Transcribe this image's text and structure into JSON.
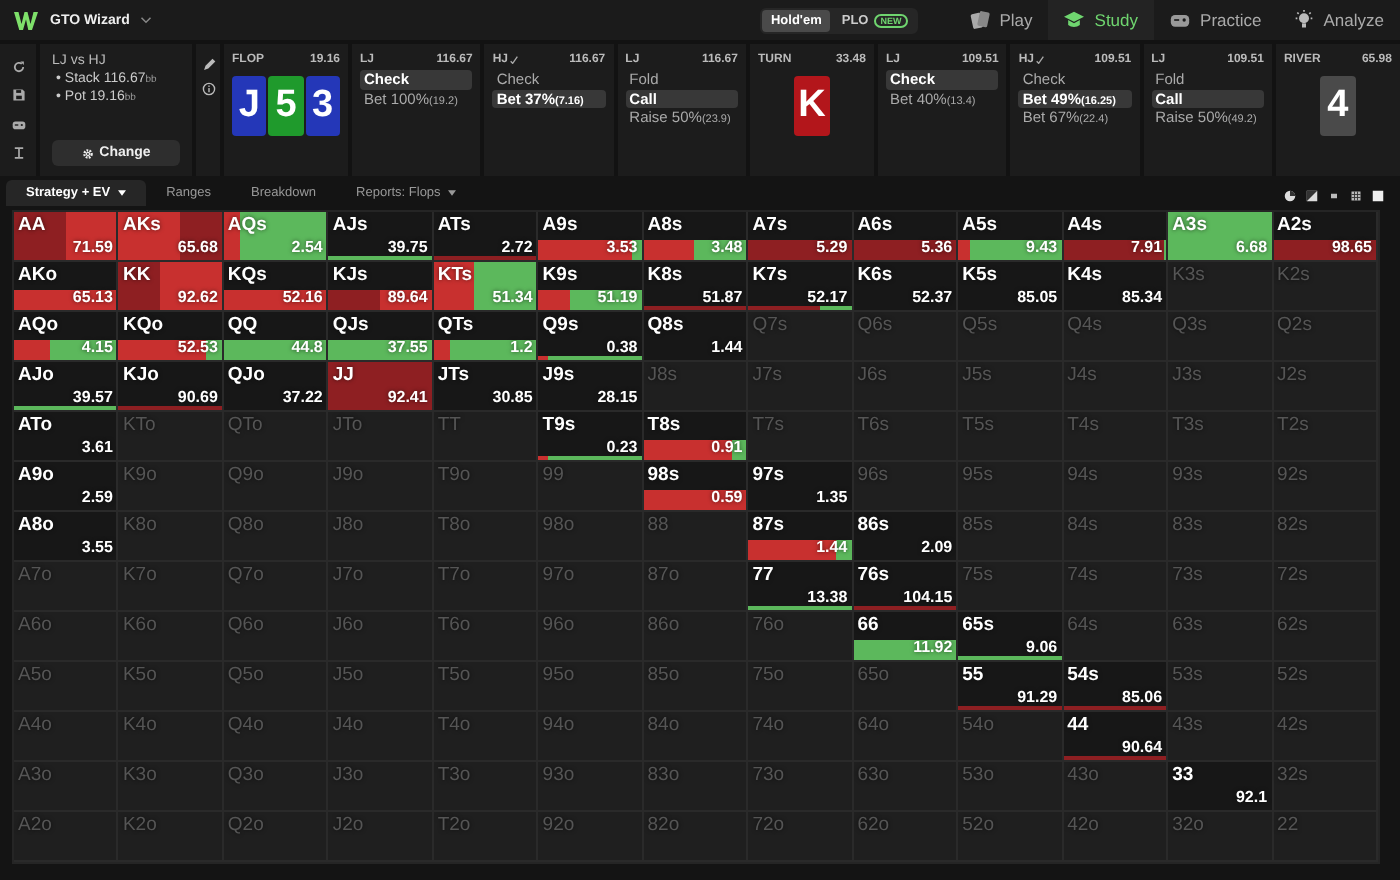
{
  "app": {
    "title": "GTO Wizard"
  },
  "variants": [
    {
      "label": "Hold'em",
      "selected": true
    },
    {
      "label": "PLO",
      "selected": false,
      "badge": "NEW"
    }
  ],
  "nav": [
    {
      "label": "Play",
      "selected": false,
      "kind": "cards"
    },
    {
      "label": "Study",
      "selected": true,
      "kind": "cap"
    },
    {
      "label": "Practice",
      "selected": false,
      "kind": "pad"
    },
    {
      "label": "Analyze",
      "selected": false,
      "kind": "bulb"
    }
  ],
  "spot": {
    "title": "LJ vs HJ",
    "stack_label": "• Stack",
    "stack": "116.67",
    "stack_unit": "bb",
    "pot_label": "• Pot",
    "pot": "19.16",
    "pot_unit": "bb",
    "button": "Change"
  },
  "line": [
    {
      "kind": "street",
      "street": "FLOP",
      "pot": "19.16",
      "cards": [
        {
          "rank": "J",
          "color": "#2437b8"
        },
        {
          "rank": "5",
          "color": "#1f9a2c"
        },
        {
          "rank": "3",
          "color": "#2437b8"
        }
      ]
    },
    {
      "kind": "action",
      "player": "LJ",
      "checkmark": false,
      "stack": "116.67",
      "options": [
        {
          "label": "Check",
          "selected": true
        },
        {
          "label": "Bet 100%",
          "amount": "(19.2)",
          "selected": false
        }
      ]
    },
    {
      "kind": "action",
      "player": "HJ",
      "checkmark": true,
      "stack": "116.67",
      "options": [
        {
          "label": "Check",
          "selected": false
        },
        {
          "label": "Bet 37%",
          "amount": "(7.16)",
          "selected": true
        }
      ]
    },
    {
      "kind": "action",
      "player": "LJ",
      "checkmark": false,
      "stack": "116.67",
      "options": [
        {
          "label": "Fold",
          "selected": false
        },
        {
          "label": "Call",
          "selected": true
        },
        {
          "label": "Raise 50%",
          "amount": "(23.9)",
          "selected": false
        }
      ]
    },
    {
      "kind": "street",
      "street": "TURN",
      "pot": "33.48",
      "cards": [
        {
          "rank": "K",
          "color": "#b3161b"
        }
      ]
    },
    {
      "kind": "action",
      "player": "LJ",
      "checkmark": false,
      "stack": "109.51",
      "options": [
        {
          "label": "Check",
          "selected": true
        },
        {
          "label": "Bet 40%",
          "amount": "(13.4)",
          "selected": false
        }
      ]
    },
    {
      "kind": "action",
      "player": "HJ",
      "checkmark": true,
      "stack": "109.51",
      "options": [
        {
          "label": "Check",
          "selected": false
        },
        {
          "label": "Bet 49%",
          "amount": "(16.25)",
          "selected": true
        },
        {
          "label": "Bet 67%",
          "amount": "(22.4)",
          "selected": false
        }
      ]
    },
    {
      "kind": "action",
      "player": "LJ",
      "checkmark": false,
      "stack": "109.51",
      "options": [
        {
          "label": "Fold",
          "selected": false
        },
        {
          "label": "Call",
          "selected": true
        },
        {
          "label": "Raise 50%",
          "amount": "(49.2)",
          "selected": false
        }
      ]
    },
    {
      "kind": "street",
      "street": "RIVER",
      "pot": "65.98",
      "cards": [
        {
          "rank": "4",
          "color": "#4a4a4a"
        }
      ]
    }
  ],
  "tabs": [
    {
      "label": "Strategy + EV",
      "selected": true,
      "dropdown": true
    },
    {
      "label": "Ranges",
      "selected": false,
      "dropdown": false
    },
    {
      "label": "Breakdown",
      "selected": false,
      "dropdown": false
    },
    {
      "label": "Reports: Flops",
      "selected": false,
      "dropdown": true
    }
  ],
  "grid": {
    "rows": [
      {
        "cells": [
          {
            "hand": "AA",
            "active": true,
            "ev": "71.59",
            "bar": {
              "kind": "full",
              "segments": [
                {
                  "color": "#8e1f22",
                  "level": 0.5
                },
                {
                  "color": "#c8302f",
                  "level": 0.5
                }
              ]
            }
          },
          {
            "hand": "AKs",
            "active": true,
            "ev": "65.68",
            "bar": {
              "kind": "full",
              "segments": [
                {
                  "color": "#c8302f",
                  "level": 0.6
                },
                {
                  "color": "#8e1f22",
                  "level": 0.4
                }
              ]
            }
          },
          {
            "hand": "AQs",
            "active": true,
            "ev": "2.54",
            "bar": {
              "kind": "full",
              "segments": [
                {
                  "color": "#c8302f",
                  "level": 0.15
                },
                {
                  "color": "#5cb85c",
                  "level": 0.85
                }
              ]
            }
          },
          {
            "hand": "AJs",
            "active": true,
            "ev": "39.75",
            "bar": {
              "kind": "line",
              "segments": [
                {
                  "color": "#5cb85c",
                  "level": 1
                }
              ]
            }
          },
          {
            "hand": "ATs",
            "active": true,
            "ev": "2.72",
            "bar": {
              "kind": "line",
              "segments": [
                {
                  "color": "#8e1f22",
                  "level": 1
                }
              ]
            }
          },
          {
            "hand": "A9s",
            "active": true,
            "ev": "3.53",
            "bar": {
              "kind": "bar",
              "segments": [
                {
                  "color": "#c8302f",
                  "level": 0.9
                },
                {
                  "color": "#5cb85c",
                  "level": 0.1
                }
              ]
            }
          },
          {
            "hand": "A8s",
            "active": true,
            "ev": "3.48",
            "bar": {
              "kind": "bar",
              "segments": [
                {
                  "color": "#c8302f",
                  "level": 0.5
                },
                {
                  "color": "#5cb85c",
                  "level": 0.5
                }
              ]
            }
          },
          {
            "hand": "A7s",
            "active": true,
            "ev": "5.29",
            "bar": {
              "kind": "bar",
              "segments": [
                {
                  "color": "#8e1f22",
                  "level": 1
                }
              ]
            }
          },
          {
            "hand": "A6s",
            "active": true,
            "ev": "5.36",
            "bar": {
              "kind": "bar",
              "segments": [
                {
                  "color": "#8e1f22",
                  "level": 1
                }
              ]
            }
          },
          {
            "hand": "A5s",
            "active": true,
            "ev": "9.43",
            "bar": {
              "kind": "bar",
              "segments": [
                {
                  "color": "#c8302f",
                  "level": 0.12
                },
                {
                  "color": "#5cb85c",
                  "level": 0.88
                }
              ]
            }
          },
          {
            "hand": "A4s",
            "active": true,
            "ev": "7.91",
            "bar": {
              "kind": "bar",
              "segments": [
                {
                  "color": "#8e1f22",
                  "level": 0.97
                },
                {
                  "color": "#5cb85c",
                  "level": 0.03
                }
              ]
            }
          },
          {
            "hand": "A3s",
            "active": true,
            "ev": "6.68",
            "bar": {
              "kind": "full",
              "segments": [
                {
                  "color": "#5cb85c",
                  "level": 1
                }
              ]
            }
          },
          {
            "hand": "A2s",
            "active": true,
            "ev": "98.65",
            "bar": {
              "kind": "bar",
              "segments": [
                {
                  "color": "#8e1f22",
                  "level": 1
                }
              ]
            }
          }
        ]
      },
      {
        "cells": [
          {
            "hand": "AKo",
            "active": true,
            "ev": "65.13",
            "bar": {
              "kind": "bar",
              "segments": [
                {
                  "color": "#c8302f",
                  "level": 1
                }
              ]
            }
          },
          {
            "hand": "KK",
            "active": true,
            "ev": "92.62",
            "bar": {
              "kind": "full",
              "segments": [
                {
                  "color": "#8e1f22",
                  "level": 0.4
                },
                {
                  "color": "#c8302f",
                  "level": 0.6
                }
              ]
            }
          },
          {
            "hand": "KQs",
            "active": true,
            "ev": "52.16",
            "bar": {
              "kind": "bar",
              "segments": [
                {
                  "color": "#c8302f",
                  "level": 1
                }
              ]
            }
          },
          {
            "hand": "KJs",
            "active": true,
            "ev": "89.64",
            "bar": {
              "kind": "bar",
              "segments": [
                {
                  "color": "#8e1f22",
                  "level": 0.5
                },
                {
                  "color": "#c8302f",
                  "level": 0.5
                }
              ]
            }
          },
          {
            "hand": "KTs",
            "active": true,
            "ev": "51.34",
            "bar": {
              "kind": "full",
              "segments": [
                {
                  "color": "#c8302f",
                  "level": 0.4
                },
                {
                  "color": "#5cb85c",
                  "level": 0.6
                }
              ]
            }
          },
          {
            "hand": "K9s",
            "active": true,
            "ev": "51.19",
            "bar": {
              "kind": "bar",
              "segments": [
                {
                  "color": "#c8302f",
                  "level": 0.3
                },
                {
                  "color": "#5cb85c",
                  "level": 0.7
                }
              ]
            }
          },
          {
            "hand": "K8s",
            "active": true,
            "ev": "51.87",
            "bar": {
              "kind": "line",
              "segments": [
                {
                  "color": "#8e1f22",
                  "level": 1
                }
              ]
            }
          },
          {
            "hand": "K7s",
            "active": true,
            "ev": "52.17",
            "bar": {
              "kind": "line",
              "segments": [
                {
                  "color": "#8e1f22",
                  "level": 0.7
                },
                {
                  "color": "#5cb85c",
                  "level": 0.3
                }
              ]
            }
          },
          {
            "hand": "K6s",
            "active": true,
            "ev": "52.37"
          },
          {
            "hand": "K5s",
            "active": true,
            "ev": "85.05"
          },
          {
            "hand": "K4s",
            "active": true,
            "ev": "85.34"
          },
          {
            "hand": "K3s",
            "active": false
          },
          {
            "hand": "K2s",
            "active": false
          }
        ]
      },
      {
        "cells": [
          {
            "hand": "AQo",
            "active": true,
            "ev": "4.15",
            "bar": {
              "kind": "bar",
              "segments": [
                {
                  "color": "#c8302f",
                  "level": 0.35
                },
                {
                  "color": "#5cb85c",
                  "level": 0.65
                }
              ]
            }
          },
          {
            "hand": "KQo",
            "active": true,
            "ev": "52.53",
            "bar": {
              "kind": "bar",
              "segments": [
                {
                  "color": "#c8302f",
                  "level": 0.85
                },
                {
                  "color": "#5cb85c",
                  "level": 0.15
                }
              ]
            }
          },
          {
            "hand": "QQ",
            "active": true,
            "ev": "44.8",
            "bar": {
              "kind": "bar",
              "segments": [
                {
                  "color": "#5cb85c",
                  "level": 1
                }
              ]
            }
          },
          {
            "hand": "QJs",
            "active": true,
            "ev": "37.55",
            "bar": {
              "kind": "bar",
              "segments": [
                {
                  "color": "#5cb85c",
                  "level": 1
                }
              ]
            }
          },
          {
            "hand": "QTs",
            "active": true,
            "ev": "1.2",
            "bar": {
              "kind": "bar",
              "segments": [
                {
                  "color": "#c8302f",
                  "level": 0.15
                },
                {
                  "color": "#5cb85c",
                  "level": 0.85
                }
              ]
            }
          },
          {
            "hand": "Q9s",
            "active": true,
            "ev": "0.38",
            "bar": {
              "kind": "line",
              "segments": [
                {
                  "color": "#c8302f",
                  "level": 0.1
                },
                {
                  "color": "#5cb85c",
                  "level": 0.9
                }
              ]
            }
          },
          {
            "hand": "Q8s",
            "active": true,
            "ev": "1.44"
          },
          {
            "hand": "Q7s",
            "active": false
          },
          {
            "hand": "Q6s",
            "active": false
          },
          {
            "hand": "Q5s",
            "active": false
          },
          {
            "hand": "Q4s",
            "active": false
          },
          {
            "hand": "Q3s",
            "active": false
          },
          {
            "hand": "Q2s",
            "active": false
          }
        ]
      },
      {
        "cells": [
          {
            "hand": "AJo",
            "active": true,
            "ev": "39.57",
            "bar": {
              "kind": "line",
              "segments": [
                {
                  "color": "#5cb85c",
                  "level": 1
                }
              ]
            }
          },
          {
            "hand": "KJo",
            "active": true,
            "ev": "90.69",
            "bar": {
              "kind": "line",
              "segments": [
                {
                  "color": "#8e1f22",
                  "level": 1
                }
              ]
            }
          },
          {
            "hand": "QJo",
            "active": true,
            "ev": "37.22"
          },
          {
            "hand": "JJ",
            "active": true,
            "ev": "92.41",
            "bar": {
              "kind": "full",
              "segments": [
                {
                  "color": "#8e1f22",
                  "level": 1
                }
              ]
            }
          },
          {
            "hand": "JTs",
            "active": true,
            "ev": "30.85"
          },
          {
            "hand": "J9s",
            "active": true,
            "ev": "28.15"
          },
          {
            "hand": "J8s",
            "active": false
          },
          {
            "hand": "J7s",
            "active": false
          },
          {
            "hand": "J6s",
            "active": false
          },
          {
            "hand": "J5s",
            "active": false
          },
          {
            "hand": "J4s",
            "active": false
          },
          {
            "hand": "J3s",
            "active": false
          },
          {
            "hand": "J2s",
            "active": false
          }
        ]
      },
      {
        "cells": [
          {
            "hand": "ATo",
            "active": true,
            "ev": "3.61"
          },
          {
            "hand": "KTo",
            "active": false
          },
          {
            "hand": "QTo",
            "active": false
          },
          {
            "hand": "JTo",
            "active": false
          },
          {
            "hand": "TT",
            "active": false
          },
          {
            "hand": "T9s",
            "active": true,
            "ev": "0.23",
            "bar": {
              "kind": "line",
              "segments": [
                {
                  "color": "#c8302f",
                  "level": 0.1
                },
                {
                  "color": "#5cb85c",
                  "level": 0.9
                }
              ]
            }
          },
          {
            "hand": "T8s",
            "active": true,
            "ev": "0.91",
            "bar": {
              "kind": "bar",
              "segments": [
                {
                  "color": "#c8302f",
                  "level": 0.85
                },
                {
                  "color": "#5cb85c",
                  "level": 0.15
                }
              ]
            }
          },
          {
            "hand": "T7s",
            "active": false
          },
          {
            "hand": "T6s",
            "active": false
          },
          {
            "hand": "T5s",
            "active": false
          },
          {
            "hand": "T4s",
            "active": false
          },
          {
            "hand": "T3s",
            "active": false
          },
          {
            "hand": "T2s",
            "active": false
          }
        ]
      },
      {
        "cells": [
          {
            "hand": "A9o",
            "active": true,
            "ev": "2.59"
          },
          {
            "hand": "K9o",
            "active": false
          },
          {
            "hand": "Q9o",
            "active": false
          },
          {
            "hand": "J9o",
            "active": false
          },
          {
            "hand": "T9o",
            "active": false
          },
          {
            "hand": "99",
            "active": false
          },
          {
            "hand": "98s",
            "active": true,
            "ev": "0.59",
            "bar": {
              "kind": "bar",
              "segments": [
                {
                  "color": "#c8302f",
                  "level": 1
                }
              ]
            }
          },
          {
            "hand": "97s",
            "active": true,
            "ev": "1.35"
          },
          {
            "hand": "96s",
            "active": false
          },
          {
            "hand": "95s",
            "active": false
          },
          {
            "hand": "94s",
            "active": false
          },
          {
            "hand": "93s",
            "active": false
          },
          {
            "hand": "92s",
            "active": false
          }
        ]
      },
      {
        "cells": [
          {
            "hand": "A8o",
            "active": true,
            "ev": "3.55"
          },
          {
            "hand": "K8o",
            "active": false
          },
          {
            "hand": "Q8o",
            "active": false
          },
          {
            "hand": "J8o",
            "active": false
          },
          {
            "hand": "T8o",
            "active": false
          },
          {
            "hand": "98o",
            "active": false
          },
          {
            "hand": "88",
            "active": false
          },
          {
            "hand": "87s",
            "active": true,
            "ev": "1.44",
            "bar": {
              "kind": "bar",
              "segments": [
                {
                  "color": "#c8302f",
                  "level": 0.85
                },
                {
                  "color": "#5cb85c",
                  "level": 0.15
                }
              ]
            }
          },
          {
            "hand": "86s",
            "active": true,
            "ev": "2.09"
          },
          {
            "hand": "85s",
            "active": false
          },
          {
            "hand": "84s",
            "active": false
          },
          {
            "hand": "83s",
            "active": false
          },
          {
            "hand": "82s",
            "active": false
          }
        ]
      },
      {
        "cells": [
          {
            "hand": "A7o",
            "active": false
          },
          {
            "hand": "K7o",
            "active": false
          },
          {
            "hand": "Q7o",
            "active": false
          },
          {
            "hand": "J7o",
            "active": false
          },
          {
            "hand": "T7o",
            "active": false
          },
          {
            "hand": "97o",
            "active": false
          },
          {
            "hand": "87o",
            "active": false
          },
          {
            "hand": "77",
            "active": true,
            "ev": "13.38",
            "bar": {
              "kind": "line",
              "segments": [
                {
                  "color": "#5cb85c",
                  "level": 1
                }
              ]
            }
          },
          {
            "hand": "76s",
            "active": true,
            "ev": "104.15",
            "bar": {
              "kind": "line",
              "segments": [
                {
                  "color": "#8e1f22",
                  "level": 1
                }
              ]
            }
          },
          {
            "hand": "75s",
            "active": false
          },
          {
            "hand": "74s",
            "active": false
          },
          {
            "hand": "73s",
            "active": false
          },
          {
            "hand": "72s",
            "active": false
          }
        ]
      },
      {
        "cells": [
          {
            "hand": "A6o",
            "active": false
          },
          {
            "hand": "K6o",
            "active": false
          },
          {
            "hand": "Q6o",
            "active": false
          },
          {
            "hand": "J6o",
            "active": false
          },
          {
            "hand": "T6o",
            "active": false
          },
          {
            "hand": "96o",
            "active": false
          },
          {
            "hand": "86o",
            "active": false
          },
          {
            "hand": "76o",
            "active": false
          },
          {
            "hand": "66",
            "active": true,
            "ev": "11.92",
            "bar": {
              "kind": "bar",
              "segments": [
                {
                  "color": "#5cb85c",
                  "level": 1
                }
              ]
            }
          },
          {
            "hand": "65s",
            "active": true,
            "ev": "9.06",
            "bar": {
              "kind": "line",
              "segments": [
                {
                  "color": "#5cb85c",
                  "level": 1
                }
              ]
            }
          },
          {
            "hand": "64s",
            "active": false
          },
          {
            "hand": "63s",
            "active": false
          },
          {
            "hand": "62s",
            "active": false
          }
        ]
      },
      {
        "cells": [
          {
            "hand": "A5o",
            "active": false
          },
          {
            "hand": "K5o",
            "active": false
          },
          {
            "hand": "Q5o",
            "active": false
          },
          {
            "hand": "J5o",
            "active": false
          },
          {
            "hand": "T5o",
            "active": false
          },
          {
            "hand": "95o",
            "active": false
          },
          {
            "hand": "85o",
            "active": false
          },
          {
            "hand": "75o",
            "active": false
          },
          {
            "hand": "65o",
            "active": false
          },
          {
            "hand": "55",
            "active": true,
            "ev": "91.29",
            "bar": {
              "kind": "line",
              "segments": [
                {
                  "color": "#8e1f22",
                  "level": 1
                }
              ]
            }
          },
          {
            "hand": "54s",
            "active": true,
            "ev": "85.06",
            "bar": {
              "kind": "line",
              "segments": [
                {
                  "color": "#8e1f22",
                  "level": 1
                }
              ]
            }
          },
          {
            "hand": "53s",
            "active": false
          },
          {
            "hand": "52s",
            "active": false
          }
        ]
      },
      {
        "cells": [
          {
            "hand": "A4o",
            "active": false
          },
          {
            "hand": "K4o",
            "active": false
          },
          {
            "hand": "Q4o",
            "active": false
          },
          {
            "hand": "J4o",
            "active": false
          },
          {
            "hand": "T4o",
            "active": false
          },
          {
            "hand": "94o",
            "active": false
          },
          {
            "hand": "84o",
            "active": false
          },
          {
            "hand": "74o",
            "active": false
          },
          {
            "hand": "64o",
            "active": false
          },
          {
            "hand": "54o",
            "active": false
          },
          {
            "hand": "44",
            "active": true,
            "ev": "90.64",
            "bar": {
              "kind": "line",
              "segments": [
                {
                  "color": "#8e1f22",
                  "level": 1
                }
              ]
            }
          },
          {
            "hand": "43s",
            "active": false
          },
          {
            "hand": "42s",
            "active": false
          }
        ]
      },
      {
        "cells": [
          {
            "hand": "A3o",
            "active": false
          },
          {
            "hand": "K3o",
            "active": false
          },
          {
            "hand": "Q3o",
            "active": false
          },
          {
            "hand": "J3o",
            "active": false
          },
          {
            "hand": "T3o",
            "active": false
          },
          {
            "hand": "93o",
            "active": false
          },
          {
            "hand": "83o",
            "active": false
          },
          {
            "hand": "73o",
            "active": false
          },
          {
            "hand": "63o",
            "active": false
          },
          {
            "hand": "53o",
            "active": false
          },
          {
            "hand": "43o",
            "active": false
          },
          {
            "hand": "33",
            "active": true,
            "ev": "92.1"
          },
          {
            "hand": "32s",
            "active": false
          }
        ]
      },
      {
        "cells": [
          {
            "hand": "A2o",
            "active": false
          },
          {
            "hand": "K2o",
            "active": false
          },
          {
            "hand": "Q2o",
            "active": false
          },
          {
            "hand": "J2o",
            "active": false
          },
          {
            "hand": "T2o",
            "active": false
          },
          {
            "hand": "92o",
            "active": false
          },
          {
            "hand": "82o",
            "active": false
          },
          {
            "hand": "72o",
            "active": false
          },
          {
            "hand": "62o",
            "active": false
          },
          {
            "hand": "52o",
            "active": false
          },
          {
            "hand": "42o",
            "active": false
          },
          {
            "hand": "32o",
            "active": false
          },
          {
            "hand": "22",
            "active": false
          }
        ]
      }
    ]
  }
}
